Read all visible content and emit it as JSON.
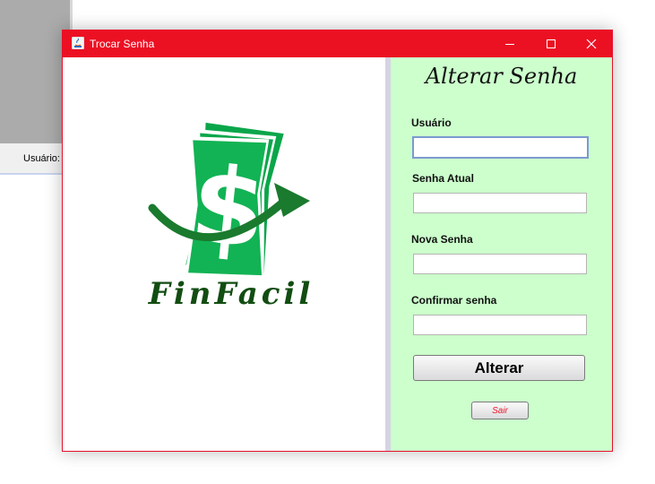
{
  "background_app": {
    "field_label": "Usuário:"
  },
  "window": {
    "title": "Trocar Senha",
    "controls": [
      "minimize",
      "maximize",
      "close"
    ],
    "accent_color": "#ec1023"
  },
  "logo": {
    "brand_name": "FinFacil",
    "icon": "money-dollar-arrow-icon",
    "green_color": "#0aa64a"
  },
  "form": {
    "title": "Alterar Senha",
    "background_color": "#ccffcc",
    "fields": [
      {
        "label": "Usuário",
        "value": "",
        "focused": true
      },
      {
        "label": "Senha Atual",
        "value": ""
      },
      {
        "label": "Nova Senha",
        "value": ""
      },
      {
        "label": "Confirmar senha",
        "value": ""
      }
    ],
    "submit_label": "Alterar",
    "exit_label": "Sair",
    "exit_color": "#ea1b2c"
  }
}
